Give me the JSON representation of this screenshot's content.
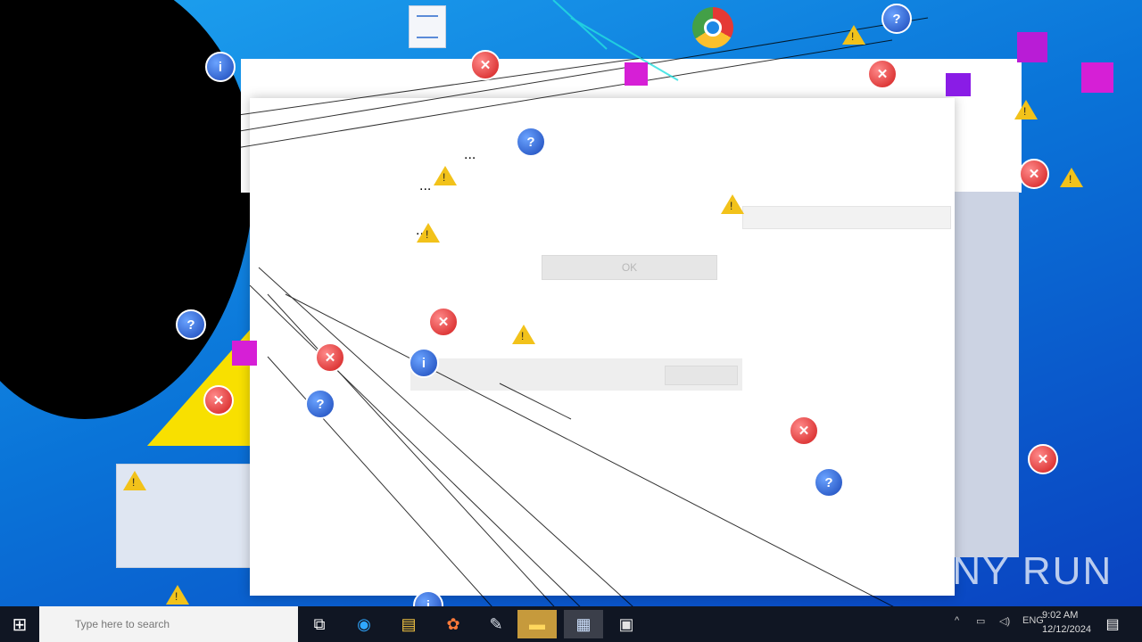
{
  "colors": {
    "accent": "#3b7fd6",
    "desktop": "#0a74d8",
    "taskbar": "#101623"
  },
  "desktop": {
    "icon_top_label": "Word document"
  },
  "dialog": {
    "header_link": "...",
    "message": "...",
    "link_text": "...",
    "ok_label": "OK"
  },
  "taskbar": {
    "start_icon": "windows-start-icon",
    "search_placeholder": "Type here to search",
    "icons": [
      "task-view-icon",
      "edge-icon",
      "file-explorer-icon",
      "paint-icon",
      "paint-app-icon",
      "folder-icon",
      "network-icon",
      "printer-icon"
    ],
    "time": "9:02 AM",
    "date": "12/12/2024"
  },
  "watermark": "ANY RUN"
}
